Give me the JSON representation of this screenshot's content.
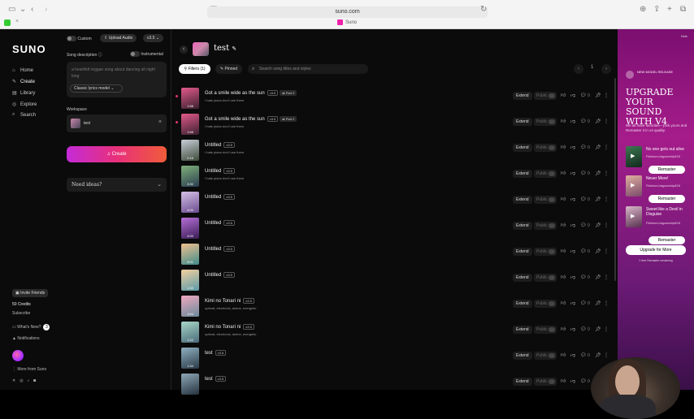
{
  "browser": {
    "url": "suno.com",
    "tab_title": "Suno",
    "tab_close": "×"
  },
  "sidebar": {
    "logo": "SUNO",
    "nav": [
      {
        "label": "Home",
        "icon": "home-icon",
        "glyph": "⌂"
      },
      {
        "label": "Create",
        "icon": "create-icon",
        "glyph": "✎"
      },
      {
        "label": "Library",
        "icon": "library-icon",
        "glyph": "▤"
      },
      {
        "label": "Explore",
        "icon": "explore-icon",
        "glyph": "◎"
      },
      {
        "label": "Search",
        "icon": "search-icon",
        "glyph": "⌕"
      }
    ],
    "invite": "Invite Friends",
    "credits": "50 Credits",
    "subscribe": "Subscribe",
    "whats_new": "What's New?",
    "whats_new_count": "3",
    "notifications": "Notifications",
    "more_from_suno": "More from Suno"
  },
  "create_panel": {
    "custom_label": "Custom",
    "upload_label": "Upload Audio",
    "version": "v3.5",
    "song_description_label": "Song description",
    "instrumental_label": "Instrumental",
    "description_placeholder": "a heartfelt reggae song about dancing all night long",
    "model_button": "Classic lyrics model",
    "workspace_label": "Workspace",
    "workspace_name": "test",
    "create_button": "Create",
    "need_ideas": "Need ideas?"
  },
  "main": {
    "title": "test",
    "filters_label": "Filters (1)",
    "pinned_label": "Pinned",
    "search_placeholder": "Search song titles and styles",
    "page": "1",
    "songs": [
      {
        "title": "Got a smile wide as the sun",
        "version": "v3.5",
        "part": "Part 2",
        "style": "I hate piano don't use them",
        "duration": "1:58",
        "likes": "0",
        "dot": true,
        "c1": "#e25a8a",
        "c2": "#3a2030"
      },
      {
        "title": "Got a smile wide as the sun",
        "version": "v3.5",
        "part": "Part 2",
        "style": "I hate piano don't use them",
        "duration": "1:58",
        "likes": "0",
        "dot": true,
        "c1": "#e25a8a",
        "c2": "#3a2030"
      },
      {
        "title": "Untitled",
        "version": "v3.5",
        "part": "",
        "style": "I hate piano don't use them",
        "duration": "2:16",
        "likes": "0",
        "dot": false,
        "c1": "#c8cfd8",
        "c2": "#3d4a3a"
      },
      {
        "title": "Untitled",
        "version": "v3.5",
        "part": "",
        "style": "I hate piano don't use them",
        "duration": "3:30",
        "likes": "0",
        "dot": false,
        "c1": "#7fb07a",
        "c2": "#2b3d50"
      },
      {
        "title": "Untitled",
        "version": "v3.5",
        "part": "",
        "style": "",
        "duration": "4:00",
        "likes": "0",
        "dot": false,
        "c1": "#d4c0e6",
        "c2": "#6b4c90"
      },
      {
        "title": "Untitled",
        "version": "v3.5",
        "part": "",
        "style": "",
        "duration": "4:00",
        "likes": "0",
        "dot": false,
        "c1": "#b56fd8",
        "c2": "#3a1d55"
      },
      {
        "title": "Untitled",
        "version": "v3.5",
        "part": "",
        "style": "",
        "duration": "3:01",
        "likes": "0",
        "dot": false,
        "c1": "#f0c090",
        "c2": "#3e8c8a"
      },
      {
        "title": "Untitled",
        "version": "v3.5",
        "part": "",
        "style": "",
        "duration": "1:33",
        "likes": "0",
        "dot": false,
        "c1": "#f3d0a0",
        "c2": "#5a9aa8"
      },
      {
        "title": "Kimi no Tonari ni",
        "version": "v3.5",
        "part": "",
        "style": "upbeat, electronic, anime, energetic",
        "duration": "1:54",
        "likes": "0",
        "dot": false,
        "c1": "#f0a8c0",
        "c2": "#6a8a9a"
      },
      {
        "title": "Kimi no Tonari ni",
        "version": "v3.5",
        "part": "",
        "style": "upbeat, electronic, anime, energetic",
        "duration": "1:22",
        "likes": "0",
        "dot": false,
        "c1": "#a8d8c8",
        "c2": "#4a6a7a"
      },
      {
        "title": "test",
        "version": "v3.5",
        "part": "",
        "style": "",
        "duration": "1:34",
        "likes": "0",
        "dot": false,
        "c1": "#90b0c0",
        "c2": "#2a3a48"
      },
      {
        "title": "test",
        "version": "v3.5",
        "part": "",
        "style": "",
        "duration": "",
        "likes": "0",
        "dot": false,
        "c1": "#8fa8b8",
        "c2": "#26323e"
      }
    ],
    "extend_label": "Extend",
    "public_label": "Public"
  },
  "promo": {
    "hide": "Hide",
    "new_model": "NEW MODEL RELEASE",
    "headline": "UPGRADE YOUR SOUND WITH V4",
    "subtext": "We all have favorites—pick yours and Remaster it in v4 quality.",
    "songs": [
      {
        "title": "No one gets out alive",
        "artist": "PlatinumJaguarship828",
        "button": "Remaster",
        "c1": "#3c7a52",
        "c2": "#12281c"
      },
      {
        "title": "Never More!",
        "artist": "PlatinumJaguarship828",
        "button": "Remaster",
        "c1": "#e0b0a0",
        "c2": "#7a4a6a"
      },
      {
        "title": "Sweet like a Devil in Disguise",
        "artist": "PlatinumJaguarship828",
        "button": "Remaster",
        "c1": "#d8b8c8",
        "c2": "#5a3050"
      }
    ],
    "upgrade_button": "Upgrade for More",
    "upgrade_note": "1 free Remaster remaining"
  }
}
